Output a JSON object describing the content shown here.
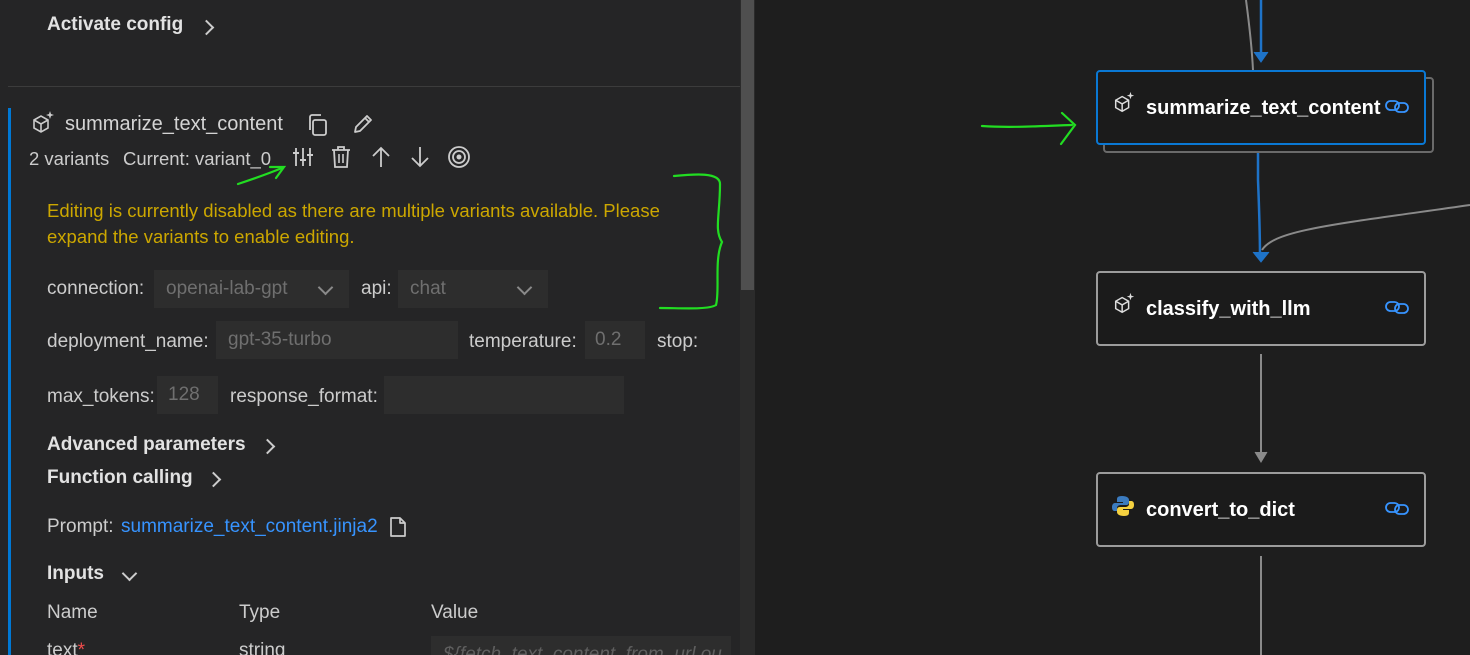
{
  "panel": {
    "activate_config": "Activate config",
    "node_name": "summarize_text_content",
    "variants_count": "2 variants",
    "current_variant": "Current: variant_0",
    "warning": "Editing is currently disabled as there are multiple variants available. Please expand the variants to enable editing.",
    "connection_label": "connection:",
    "connection_value": "openai-lab-gpt",
    "api_label": "api:",
    "api_value": "chat",
    "deployment_label": "deployment_name:",
    "deployment_value": "gpt-35-turbo",
    "temperature_label": "temperature:",
    "temperature_value": "0.2",
    "stop_label": "stop:",
    "max_tokens_label": "max_tokens:",
    "max_tokens_value": "128",
    "response_format_label": "response_format:",
    "response_format_value": "",
    "advanced_parameters": "Advanced parameters",
    "function_calling": "Function calling",
    "prompt_label": "Prompt:",
    "prompt_file": "summarize_text_content.jinja2",
    "inputs_label": "Inputs",
    "inputs_table": {
      "headers": [
        "Name",
        "Type",
        "Value"
      ],
      "rows": [
        {
          "name": "text",
          "required": "*",
          "type": "string",
          "value": "${fetch_text_content_from_url.ou"
        }
      ]
    }
  },
  "graph": {
    "nodes": [
      {
        "label": "summarize_text_content",
        "icon": "llm-sparkle-icon",
        "selected": true
      },
      {
        "label": "classify_with_llm",
        "icon": "llm-sparkle-icon",
        "selected": false
      },
      {
        "label": "convert_to_dict",
        "icon": "python-icon",
        "selected": false
      }
    ]
  },
  "colors": {
    "accent": "#0078d4",
    "warning": "#cca700",
    "link": "#3794ff",
    "annotation": "#22dd22"
  }
}
